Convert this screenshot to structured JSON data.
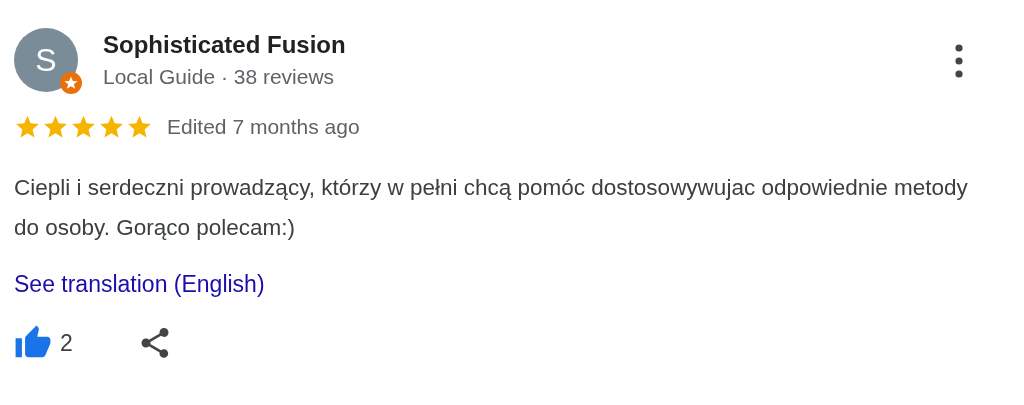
{
  "review": {
    "avatar_letter": "S",
    "local_guide": true,
    "author": "Sophisticated Fusion",
    "subtitle": "Local Guide · 38 reviews",
    "stars": 5,
    "date": "Edited 7 months ago",
    "text": "Ciepli i serdeczni prowadzący, którzy w pełni chcą pomóc dostosowywujac odpowiednie metody do osoby. Gorąco polecam:)",
    "translation_link": "See translation (English)",
    "liked": true,
    "like_count": "2"
  }
}
